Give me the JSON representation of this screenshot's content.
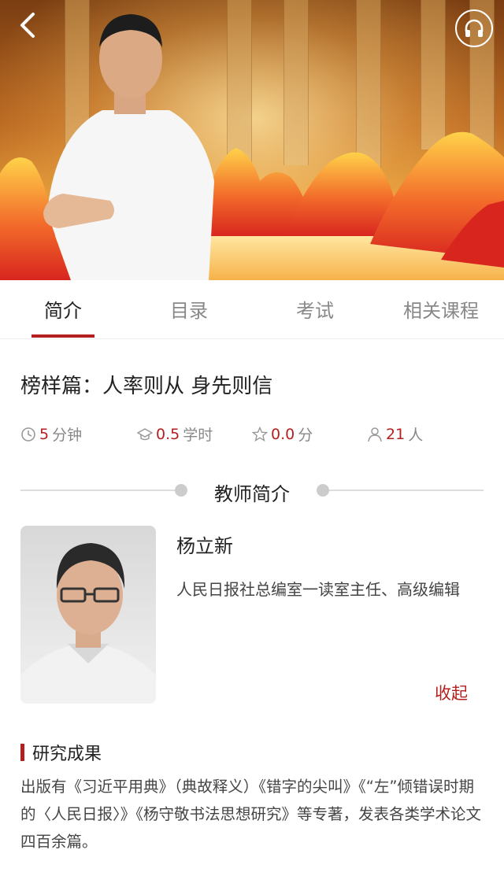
{
  "header": {
    "back_icon": "chevron-left-icon",
    "audio_icon": "headphones-icon"
  },
  "tabs": [
    {
      "label": "简介",
      "active": true
    },
    {
      "label": "目录",
      "active": false
    },
    {
      "label": "考试",
      "active": false
    },
    {
      "label": "相关课程",
      "active": false
    }
  ],
  "course": {
    "title": "榜样篇：人率则从  身先则信",
    "duration_value": "5",
    "duration_unit": "分钟",
    "credit_value": "0.5",
    "credit_unit": "学时",
    "rating_value": "0.0",
    "rating_unit": "分",
    "learners_value": "21",
    "learners_unit": "人"
  },
  "teacher_section": {
    "heading": "教师简介",
    "name": "杨立新",
    "description": "人民日报社总编室一读室主任、高级编辑",
    "collapse_label": "收起"
  },
  "research": {
    "heading": "研究成果",
    "text": "出版有《习近平用典》（典故释义）《错字的尖叫》《“左”倾错误时期的〈人民日报〉》《杨守敬书法思想研究》等专著，发表各类学术论文四百余篇。"
  },
  "colors": {
    "accent": "#b41f1f",
    "muted": "#888888"
  }
}
